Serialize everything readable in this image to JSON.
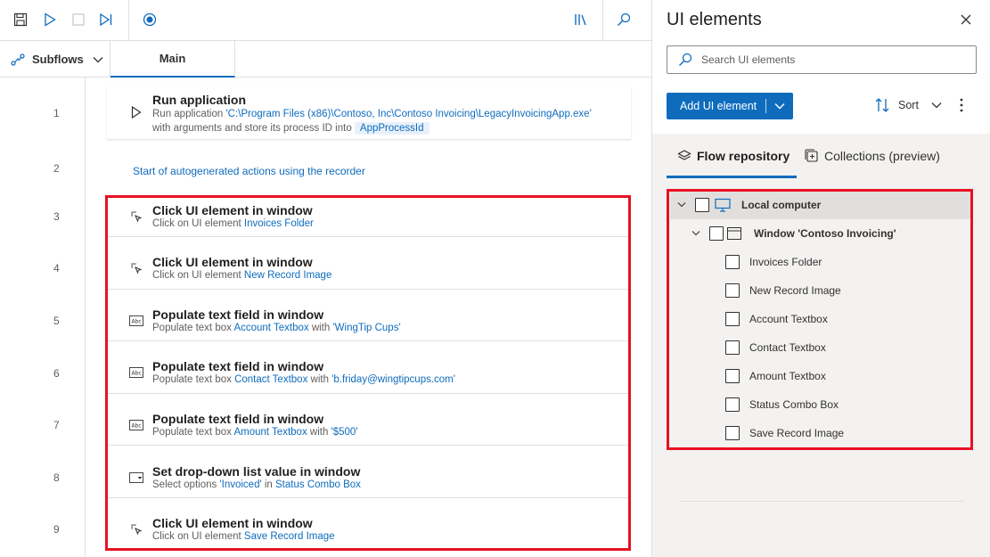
{
  "toolbar": {
    "icons": [
      "save-icon",
      "run-icon",
      "stop-icon",
      "run-next-action-icon",
      "record-icon",
      "library-icon",
      "search-icon"
    ]
  },
  "tabs": {
    "subflows_label": "Subflows",
    "main_label": "Main"
  },
  "steps": [
    {
      "line": "1",
      "title": "Run application",
      "desc_prefix": "Run application ",
      "desc_link": "'C:\\Program Files (x86)\\Contoso, Inc\\Contoso Invoicing\\LegacyInvoicingApp.exe'",
      "desc2_prefix": "with arguments  and store its process ID into ",
      "desc2_var": "AppProcessId"
    },
    {
      "line": "2",
      "comment": "Start of autogenerated actions using the recorder"
    },
    {
      "line": "3",
      "title": "Click UI element in window",
      "desc_prefix": "Click on UI element ",
      "desc_link": "Invoices Folder"
    },
    {
      "line": "4",
      "title": "Click UI element in window",
      "desc_prefix": "Click on UI element ",
      "desc_link": "New Record Image"
    },
    {
      "line": "5",
      "title": "Populate text field in window",
      "desc_prefix": "Populate text box ",
      "desc_link": "Account Textbox",
      "desc_mid": " with ",
      "desc_value": "'WingTip Cups'"
    },
    {
      "line": "6",
      "title": "Populate text field in window",
      "desc_prefix": "Populate text box ",
      "desc_link": "Contact Textbox",
      "desc_mid": " with ",
      "desc_value": "'b.friday@wingtipcups.com'"
    },
    {
      "line": "7",
      "title": "Populate text field in window",
      "desc_prefix": "Populate text box ",
      "desc_link": "Amount Textbox",
      "desc_mid": " with ",
      "desc_value": "'$500'"
    },
    {
      "line": "8",
      "title": "Set drop-down list value in window",
      "desc_prefix": "Select options ",
      "desc_link": "'Invoiced'",
      "desc_mid": " in ",
      "desc_value": "Status Combo Box"
    },
    {
      "line": "9",
      "title": "Click UI element in window",
      "desc_prefix": "Click on UI element ",
      "desc_link": "Save Record Image"
    }
  ],
  "panel": {
    "title": "UI elements",
    "search_placeholder": "Search UI elements",
    "add_button": "Add UI element",
    "sort_label": "Sort",
    "tab_repository": "Flow repository",
    "tab_collections": "Collections (preview)",
    "tree": {
      "root": "Local computer",
      "window": "Window 'Contoso Invoicing'",
      "items": [
        "Invoices Folder",
        "New Record Image",
        "Account Textbox",
        "Contact Textbox",
        "Amount Textbox",
        "Status Combo Box",
        "Save Record Image"
      ]
    }
  },
  "colors": {
    "accent": "#0f6cbd",
    "highlight": "#e81123",
    "panel_bg": "#f3f2f1"
  }
}
